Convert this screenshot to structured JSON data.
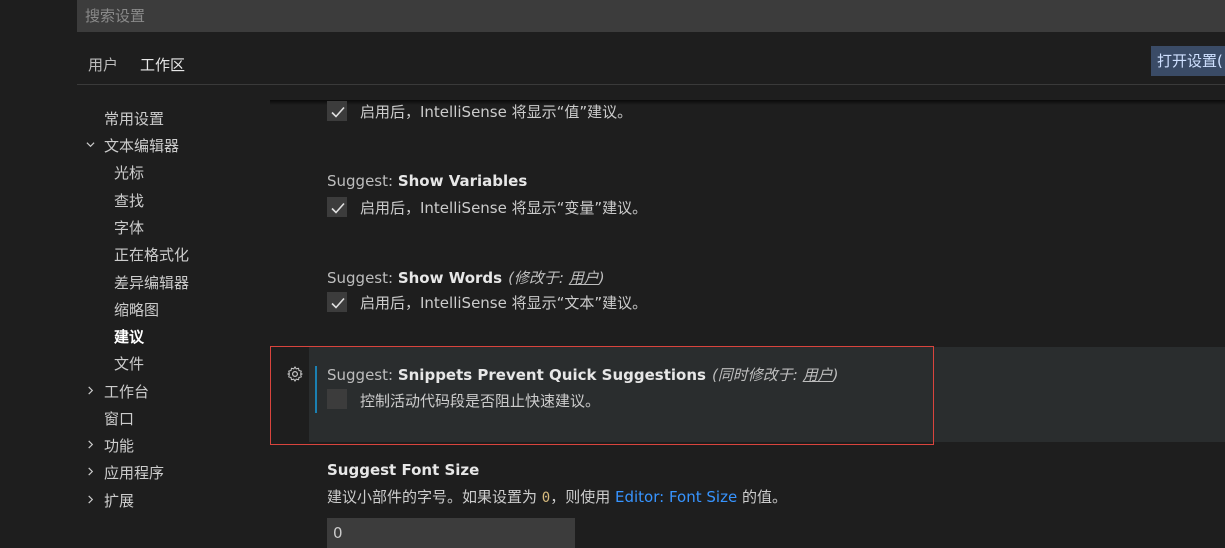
{
  "search": {
    "placeholder": "搜索设置"
  },
  "tabs": [
    {
      "label": "用户"
    },
    {
      "label": "工作区"
    }
  ],
  "open_json_button": "打开设置(",
  "toc": {
    "items": [
      {
        "label": "常用设置"
      },
      {
        "label": "文本编辑器",
        "expanded": true
      },
      {
        "label": "光标"
      },
      {
        "label": "查找"
      },
      {
        "label": "字体"
      },
      {
        "label": "正在格式化"
      },
      {
        "label": "差异编辑器"
      },
      {
        "label": "缩略图"
      },
      {
        "label": "建议",
        "selected": true
      },
      {
        "label": "文件"
      },
      {
        "label": "工作台",
        "expanded": false
      },
      {
        "label": "窗口"
      },
      {
        "label": "功能",
        "expanded": false
      },
      {
        "label": "应用程序",
        "expanded": false
      },
      {
        "label": "扩展",
        "expanded": false
      }
    ]
  },
  "settings": {
    "show_values": {
      "description": "启用后，IntelliSense 将显示“值”建议。",
      "checked": true
    },
    "show_variables": {
      "category": "Suggest: ",
      "name": "Show Variables",
      "description": "启用后，IntelliSense 将显示“变量”建议。",
      "checked": true
    },
    "show_words": {
      "category": "Suggest: ",
      "name": "Show Words",
      "modified_prefix": "(修改于: ",
      "modified_scope": "用户",
      "modified_suffix": ")",
      "description": "启用后，IntelliSense 将显示“文本”建议。",
      "checked": true
    },
    "snippets_prevent": {
      "category": "Suggest: ",
      "name": "Snippets Prevent Quick Suggestions",
      "modified_prefix": "(同时修改于: ",
      "modified_scope": "用户",
      "modified_suffix": ")",
      "description": "控制活动代码段是否阻止快速建议。",
      "checked": false
    },
    "font_size": {
      "name": "Suggest Font Size",
      "desc_part1": "建议小部件的字号。如果设置为 ",
      "desc_code": "0",
      "desc_part2": "，则使用 ",
      "desc_link": "Editor: Font Size",
      "desc_part3": " 的值。",
      "value": "0"
    }
  },
  "colors": {
    "accent_link": "#3794ff",
    "focus_outline": "#d9443d",
    "modified_bar": "#1b80b2"
  }
}
